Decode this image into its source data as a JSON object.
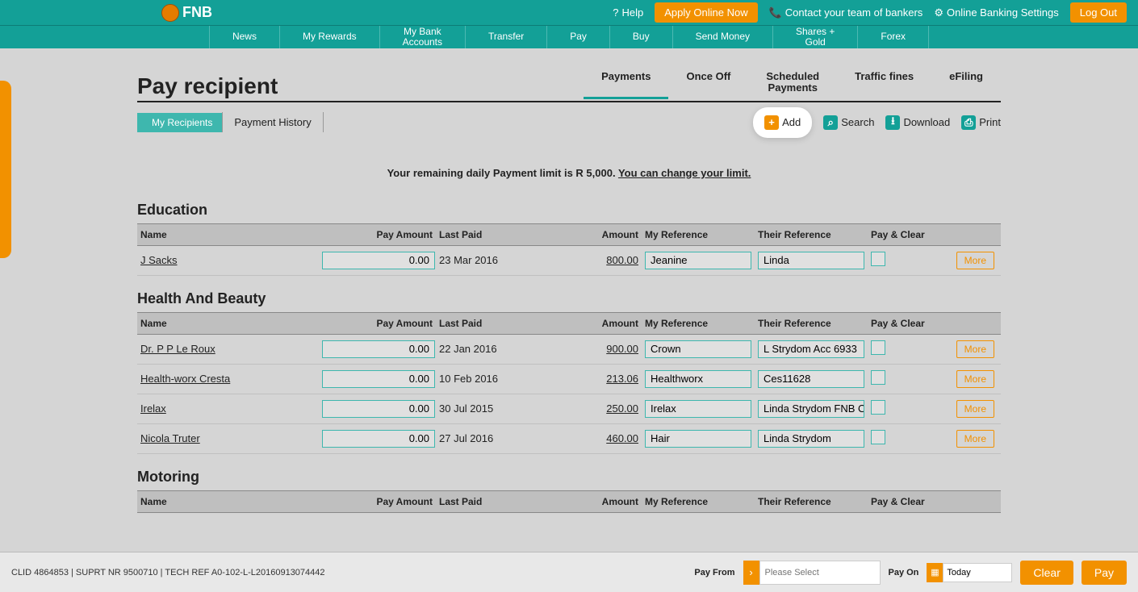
{
  "topbar": {
    "brand": "FNB",
    "help": "Help",
    "apply": "Apply Online Now",
    "contact": "Contact your team of bankers",
    "settings": "Online Banking Settings",
    "logout": "Log Out"
  },
  "menu": [
    "News",
    "My Rewards",
    "My Bank Accounts",
    "Transfer",
    "Pay",
    "Buy",
    "Send Money",
    "Shares + Gold",
    "Forex"
  ],
  "page_title": "Pay recipient",
  "tabs": [
    {
      "label": "Payments",
      "active": true
    },
    {
      "label": "Once Off",
      "active": false
    },
    {
      "label": "Scheduled Payments",
      "active": false
    },
    {
      "label": "Traffic fines",
      "active": false
    },
    {
      "label": "eFiling",
      "active": false
    }
  ],
  "subnav": {
    "my_recipients": "My Recipients",
    "history": "Payment History"
  },
  "actions": {
    "add": "Add",
    "search": "Search",
    "download": "Download",
    "print": "Print"
  },
  "limit": {
    "prefix": "Your remaining daily Payment limit is R 5,000. ",
    "link": "You can change your limit."
  },
  "columns": {
    "name": "Name",
    "pay_amount": "Pay Amount",
    "last_paid": "Last Paid",
    "amount": "Amount",
    "my_ref": "My Reference",
    "their_ref": "Their Reference",
    "pay_clear": "Pay & Clear",
    "more": "More"
  },
  "sections": [
    {
      "title": "Education",
      "rows": [
        {
          "name": "J Sacks",
          "pay_amount": "0.00",
          "last_paid": "23 Mar 2016",
          "amount": "800.00",
          "my_ref": "Jeanine",
          "their_ref": "Linda"
        }
      ]
    },
    {
      "title": "Health And Beauty",
      "rows": [
        {
          "name": "Dr. P P Le Roux",
          "pay_amount": "0.00",
          "last_paid": "22 Jan 2016",
          "amount": "900.00",
          "my_ref": "Crown",
          "their_ref": "L Strydom Acc 6933"
        },
        {
          "name": "Health-worx Cresta",
          "pay_amount": "0.00",
          "last_paid": "10 Feb 2016",
          "amount": "213.06",
          "my_ref": "Healthworx",
          "their_ref": "Ces11628"
        },
        {
          "name": "Irelax",
          "pay_amount": "0.00",
          "last_paid": "30 Jul 2015",
          "amount": "250.00",
          "my_ref": "Irelax",
          "their_ref": "Linda Strydom FNB On"
        },
        {
          "name": "Nicola Truter",
          "pay_amount": "0.00",
          "last_paid": "27 Jul 2016",
          "amount": "460.00",
          "my_ref": "Hair",
          "their_ref": "Linda Strydom"
        }
      ]
    },
    {
      "title": "Motoring",
      "rows": []
    }
  ],
  "footer": {
    "info": "CLID 4864853 | SUPRT NR 9500710 | TECH REF A0-102-L-L20160913074442",
    "pay_from": "Pay From",
    "pay_from_placeholder": "Please Select",
    "pay_on": "Pay On",
    "pay_on_value": "Today",
    "clear": "Clear",
    "pay": "Pay"
  }
}
